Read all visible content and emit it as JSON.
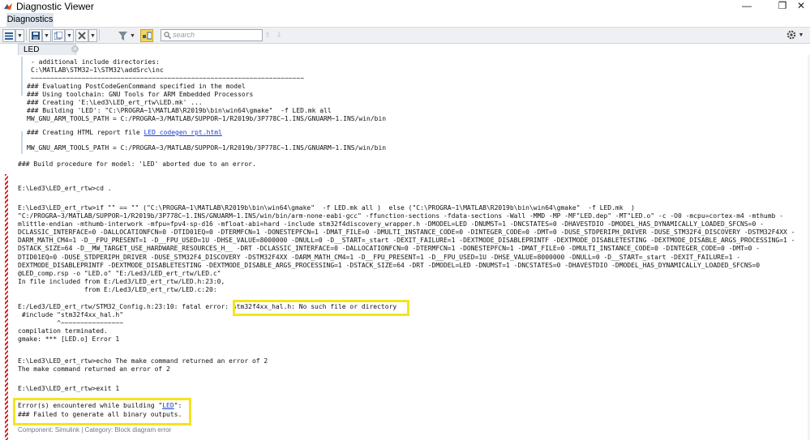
{
  "window": {
    "title": "Diagnostic Viewer",
    "minimize_glyph": "—",
    "restore_glyph": "❐",
    "close_glyph": "✕"
  },
  "menu": {
    "tab_label": "Diagnostics"
  },
  "toolbar": {
    "search_placeholder": "search",
    "up_arrow": "⇧",
    "down_arrow": "⇩"
  },
  "tab": {
    "label": "LED",
    "close_glyph": "×"
  },
  "log": {
    "include_lines": "- additional include directories:\nC:\\MATLAB\\STM32~1\\STM32\\addSrc\\inc\n~~~~~~~~~~~~~~~~~~~~~~~~~~~~~~~~~~~~~~~~~~~~~~~~~~~~~~~~~~~~~~~~~~~~~~",
    "postcode_lines": "### Evaluating PostCodeGenCommand specified in the model\n### Using toolchain: GNU Tools for ARM Embedded Processors\n### Creating 'E:\\Led3\\LED_ert_rtw\\LED.mk' ...\n### Building 'LED': \"C:\\PROGRA~1\\MATLAB\\R2019b\\bin\\win64\\gmake\"  -f LED.mk all\nMW_GNU_ARM_TOOLS_PATH = C:/PROGRA~3/MATLAB/SUPPOR~1/R2019b/3P778C~1.INS/GNUARM~1.INS/win/bin",
    "report_prefix": "### Creating HTML report file ",
    "report_link": "LED codegen rpt.html",
    "tools_path": "MW_GNU_ARM_TOOLS_PATH = C:/PROGRA~3/MATLAB/SUPPOR~1/R2019b/3P778C~1.INS/GNUARM~1.INS/win/bin",
    "aborted": "### Build procedure for model: 'LED' aborted due to an error.",
    "cd_line": "E:\\Led3\\LED_ert_rtw>cd .",
    "build_cmd": "E:\\Led3\\LED_ert_rtw>if \"\" == \"\" (\"C:\\PROGRA~1\\MATLAB\\R2019b\\bin\\win64\\gmake\"  -f LED.mk all )  else (\"C:\\PROGRA~1\\MATLAB\\R2019b\\bin\\win64\\gmake\"  -f LED.mk  )\n\"C:/PROGRA~3/MATLAB/SUPPOR~1/R2019b/3P778C~1.INS/GNUARM~1.INS/win/bin/arm-none-eabi-gcc\" -ffunction-sections -fdata-sections -Wall -MMD -MP -MF\"LED.dep\" -MT\"LED.o\" -c -O0 -mcpu=cortex-m4 -mthumb -\nmlittle-endian -mthumb-interwork -mfpu=fpv4-sp-d16 -mfloat-abi=hard -include stm32f4discovery_wrapper.h -DMODEL=LED -DNUMST=1 -DNCSTATES=0 -DHAVESTDIO -DMODEL_HAS_DYNAMICALLY_LOADED_SFCNS=0 -\nDCLASSIC_INTERFACE=0 -DALLOCATIONFCN=0 -DTID01EQ=0 -DTERMFCN=1 -DONESTEPFCN=1 -DMAT_FILE=0 -DMULTI_INSTANCE_CODE=0 -DINTEGER_CODE=0 -DMT=0 -DUSE_STDPERIPH_DRIVER -DUSE_STM32F4_DISCOVERY -DSTM32F4XX -\nDARM_MATH_CM4=1 -D__FPU_PRESENT=1 -D__FPU_USED=1U -DHSE_VALUE=8000000 -DNULL=0 -D__START=_start -DEXIT_FAILURE=1 -DEXTMODE_DISABLEPRINTF -DEXTMODE_DISABLETESTING -DEXTMODE_DISABLE_ARGS_PROCESSING=1 -\nDSTACK_SIZE=64 -D__MW_TARGET_USE_HARDWARE_RESOURCES_H__ -DRT -DCLASSIC_INTERFACE=0 -DALLOCATIONFCN=0 -DTERMFCN=1 -DONESTEPFCN=1 -DMAT_FILE=0 -DMULTI_INSTANCE_CODE=0 -DINTEGER_CODE=0 -DMT=0 -\nDTID01EQ=0 -DUSE_STDPERIPH_DRIVER -DUSE_STM32F4_DISCOVERY -DSTM32F4XX -DARM_MATH_CM4=1 -D__FPU_PRESENT=1 -D__FPU_USED=1U -DHSE_VALUE=8000000 -DNULL=0 -D__START=_start -DEXIT_FAILURE=1 -\nDEXTMODE_DISABLEPRINTF -DEXTMODE_DISABLETESTING -DEXTMODE_DISABLE_ARGS_PROCESSING=1 -DSTACK_SIZE=64 -DRT -DMODEL=LED -DNUMST=1 -DNCSTATES=0 -DHAVESTDIO -DMODEL_HAS_DYNAMICALLY_LOADED_SFCNS=0\n@LED_comp.rsp -o \"LED.o\" \"E:/Led3/LED_ert_rtw/LED.c\"\nIn file included from E:/Led3/LED_ert_rtw/LED.h:23:0,\n                 from E:/Led3/LED_ert_rtw/LED.c:20:",
    "fatal_prefix": "E:/Led3/LED_ert_rtw/STM32_Config.h:23:10: fatal error: ",
    "fatal_msg": "stm32f4xx_hal.h: No such file or directory",
    "after_fatal": " #include \"stm32f4xx_hal.h\"\n          ^~~~~~~~~~~~~~~~~\ncompilation terminated.\ngmake: *** [LED.o] Error 1",
    "echo_lines": "E:\\Led3\\LED_ert_rtw>echo The make command returned an error of 2\nThe make command returned an error of 2",
    "exit_line": "E:\\Led3\\LED_ert_rtw>exit 1",
    "error_prefix": "Error(s) encountered while building \"",
    "error_link": "LED",
    "error_suffix": "\":",
    "failed_line": "### Failed to generate all binary outputs."
  },
  "footer": "Component:  Simulink | Category:  Block diagram error",
  "colors": {
    "highlight": "#f2e51f",
    "error_stripe": "#d72020",
    "link": "#1a3ed6"
  }
}
